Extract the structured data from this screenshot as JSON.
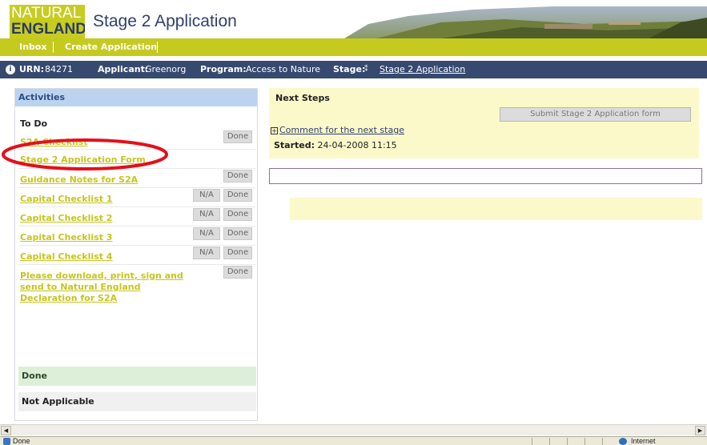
{
  "header": {
    "logo_line1": "NATURAL",
    "logo_line2": "ENGLAND",
    "title": "Stage 2 Application"
  },
  "nav": {
    "tabs": [
      {
        "label": "Inbox"
      },
      {
        "label": "Create Application"
      }
    ]
  },
  "info": {
    "urn_label": "URN:",
    "urn_value": "84271",
    "applicant_label": "Applicant:",
    "applicant_value": "Greenorg",
    "program_label": "Program:",
    "program_value": "Access to Nature",
    "stage_label": "Stage:",
    "stage_value": "Stage 2 Application"
  },
  "activities": {
    "title": "Activities",
    "todo_title": "To Do",
    "items": [
      {
        "label": "S2A Checklist",
        "na": "",
        "done": "Done"
      },
      {
        "label": "Stage 2 Application Form",
        "na": "",
        "done": ""
      },
      {
        "label": "Guidance Notes for S2A",
        "na": "",
        "done": "Done"
      },
      {
        "label": "Capital Checklist 1",
        "na": "N/A",
        "done": "Done"
      },
      {
        "label": "Capital Checklist 2",
        "na": "N/A",
        "done": "Done"
      },
      {
        "label": "Capital Checklist 3",
        "na": "N/A",
        "done": "Done"
      },
      {
        "label": "Capital Checklist 4",
        "na": "N/A",
        "done": "Done"
      },
      {
        "label_lines": [
          "Please download, print, sign and",
          "send to Natural England",
          "Declaration for S2A"
        ],
        "done": "Done"
      }
    ],
    "done_section": "Done",
    "na_section": "Not Applicable"
  },
  "next_steps": {
    "title": "Next Steps",
    "submit_label": "Submit Stage 2 Application form",
    "comment_toggle": "⊞",
    "comment_label": "Comment for the next stage",
    "started_label": "Started:",
    "started_value": "24-04-2008 11:15"
  },
  "statusbar": {
    "text": "Done",
    "zone": "Internet"
  },
  "colors": {
    "brand_green": "#c5ca1f",
    "navy": "#36496f",
    "link": "#c6c51e",
    "annotation": "#e3101a"
  }
}
